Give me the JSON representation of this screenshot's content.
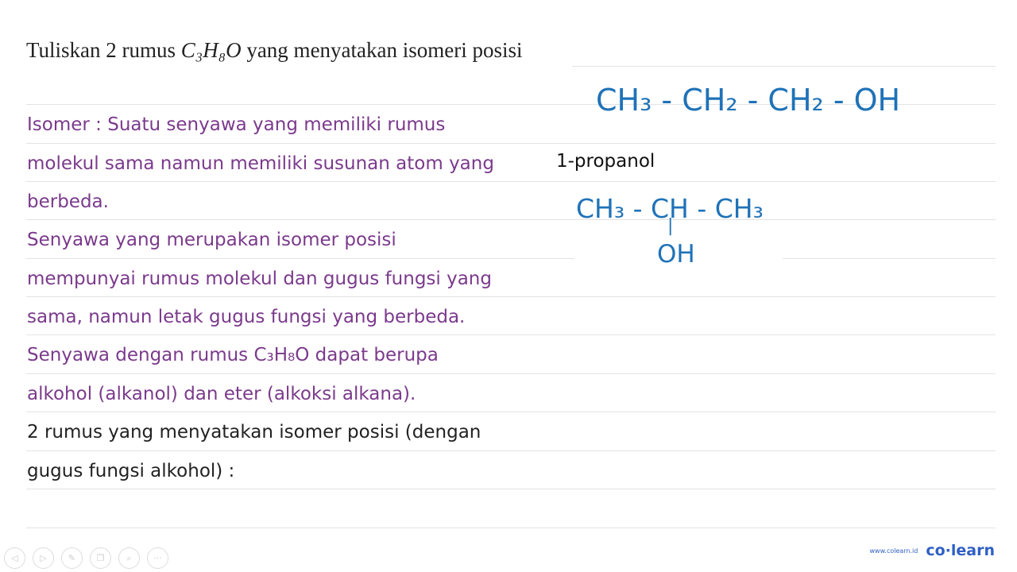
{
  "question": {
    "prefix": "Tuliskan 2 rumus ",
    "formula": "C₃H₈O",
    "suffix": " yang menyatakan isomeri posisi"
  },
  "lines": [
    "Isomer : Suatu senyawa yang memiliki rumus",
    "molekul sama namun memiliki susunan atom yang",
    "berbeda.",
    "Senyawa yang merupakan isomer posisi",
    "mempunyai rumus molekul dan gugus fungsi yang",
    "sama, namun letak gugus fungsi yang berbeda.",
    "Senyawa dengan rumus C₃H₈O dapat berupa",
    "alkohol (alkanol) dan eter (alkoksi alkana).",
    "2 rumus yang menyatakan isomer posisi (dengan",
    "gugus fungsi alkohol) :"
  ],
  "chem": {
    "structure1": "CH₃ - CH₂ - CH₂ - OH",
    "label1": "1-propanol",
    "structure2": "CH₃ - CH - CH₃",
    "branch_bond": "|",
    "branch": "OH"
  },
  "footer": {
    "url": "www.colearn.id",
    "brand": "co·learn",
    "nav_icons": [
      "prev-icon",
      "next-icon",
      "pen-icon",
      "copy-icon",
      "zoom-icon",
      "more-icon"
    ]
  },
  "colors": {
    "explanation": "#7b3a8c",
    "handwriting": "#1f72b8",
    "brand": "#2f5fc4"
  }
}
